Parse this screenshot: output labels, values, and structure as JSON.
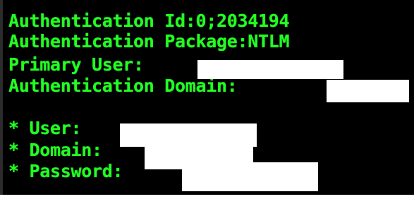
{
  "console": {
    "lines": [
      "Authentication Id:0;2034194",
      "Authentication Package:NTLM",
      "Primary User:",
      "Authentication Domain:",
      "* User:",
      "* Domain:",
      "* Password:"
    ]
  },
  "colors": {
    "background": "#000000",
    "text": "#22ff22",
    "redaction": "#ffffff"
  }
}
